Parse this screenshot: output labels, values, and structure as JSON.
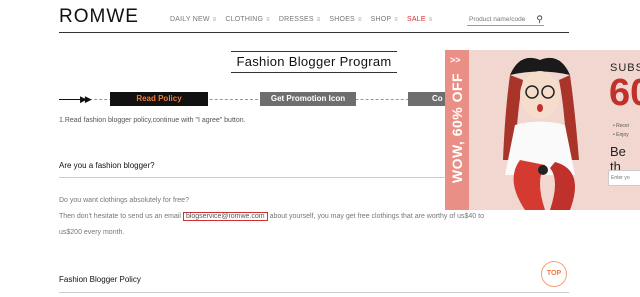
{
  "header": {
    "logo": "ROMWE",
    "nav": [
      {
        "label": "DAILY NEW",
        "sale": false
      },
      {
        "label": "CLOTHING",
        "sale": false
      },
      {
        "label": "DRESSES",
        "sale": false
      },
      {
        "label": "SHOES",
        "sale": false
      },
      {
        "label": "SHOP",
        "sale": false
      },
      {
        "label": "SALE",
        "sale": true
      }
    ],
    "nav_icon": "≡",
    "search_placeholder": "Product name/code",
    "search_icon": "search-icon"
  },
  "page": {
    "title": "Fashion Blogger Program",
    "steps": [
      "Read Policy",
      "Get Promotion Icon",
      "Co"
    ],
    "instruction": "1.Read fashion blogger policy,continue with \"I agree\" button.",
    "section1_title": "Are you a fashion blogger?",
    "section1_p1": "Do you want clothings absolutely for free?",
    "section1_p2_before": "Then don't hesitate to send us an email",
    "section1_email": "blogservice@romwe.com",
    "section1_p2_after": "about yourself, you may get free clothings that are worthy of us$40 to",
    "section1_p3": "us$200 every month.",
    "section2_title": "Fashion Blogger Policy",
    "top_button": "TOP"
  },
  "popup": {
    "close": ">>",
    "vertical_text": "WOW, 60% OFF",
    "subs": "SUBS",
    "big": "60",
    "bullets": [
      "• Recei",
      "• Enjoy"
    ],
    "beth": "Be th",
    "input_placeholder": "Enter yo"
  },
  "colors": {
    "accent_orange": "#f07a3a",
    "sale_red": "#d0302f",
    "popup_pink": "#ea8f86"
  }
}
